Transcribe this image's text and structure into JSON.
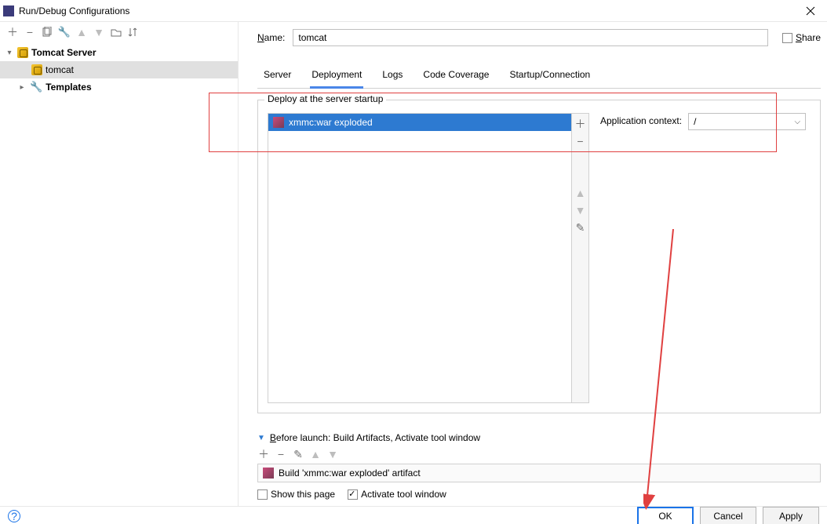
{
  "window_title": "Run/Debug Configurations",
  "share_label": "Share",
  "name_label": "Name:",
  "name_value": "tomcat",
  "tree": {
    "root_label": "Tomcat Server",
    "child_label": "tomcat",
    "templates_label": "Templates"
  },
  "tabs": {
    "server": "Server",
    "deployment": "Deployment",
    "logs": "Logs",
    "code_coverage": "Code Coverage",
    "startup": "Startup/Connection"
  },
  "group_legend": "Deploy at the server startup",
  "deploy_item": "xmmc:war exploded",
  "app_context_label": "Application context:",
  "app_context_value": "/",
  "before_launch_header": "Before launch: Build Artifacts, Activate tool window",
  "build_artifact_label": "Build 'xmmc:war exploded' artifact",
  "show_this_page": "Show this page",
  "activate_tool_window": "Activate tool window",
  "buttons": {
    "ok": "OK",
    "cancel": "Cancel",
    "apply": "Apply"
  }
}
